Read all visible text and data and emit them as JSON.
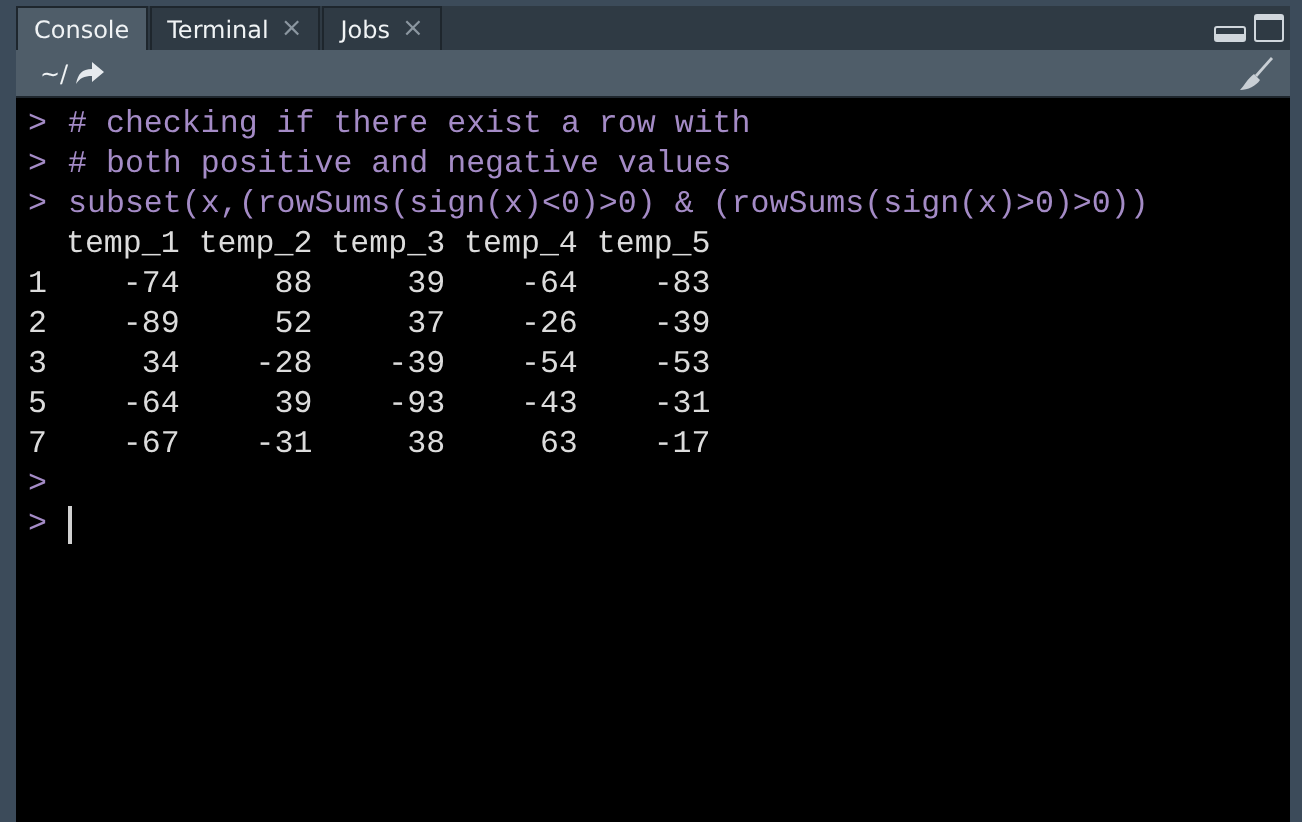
{
  "tabs": [
    {
      "label": "Console",
      "selected": true,
      "closable": false
    },
    {
      "label": "Terminal",
      "selected": false,
      "closable": true,
      "close": "×"
    },
    {
      "label": "Jobs",
      "selected": false,
      "closable": true,
      "close": "×"
    }
  ],
  "toolbar": {
    "path": "~/"
  },
  "console": [
    {
      "kind": "input",
      "prompt": ">",
      "text": "# checking if there exist a row with"
    },
    {
      "kind": "input",
      "prompt": ">",
      "text": "# both positive and negative values"
    },
    {
      "kind": "input",
      "prompt": ">",
      "text": "subset(x,(rowSums(sign(x)<0)>0) & (rowSums(sign(x)>0)>0))"
    },
    {
      "kind": "output",
      "text": "  temp_1 temp_2 temp_3 temp_4 temp_5"
    },
    {
      "kind": "output",
      "text": "1    -74     88     39    -64    -83"
    },
    {
      "kind": "output",
      "text": "2    -89     52     37    -26    -39"
    },
    {
      "kind": "output",
      "text": "3     34    -28    -39    -54    -53"
    },
    {
      "kind": "output",
      "text": "5    -64     39    -93    -43    -31"
    },
    {
      "kind": "output",
      "text": "7    -67    -31     38     63    -17"
    },
    {
      "kind": "input",
      "prompt": ">"
    },
    {
      "kind": "current",
      "prompt": ">"
    }
  ]
}
